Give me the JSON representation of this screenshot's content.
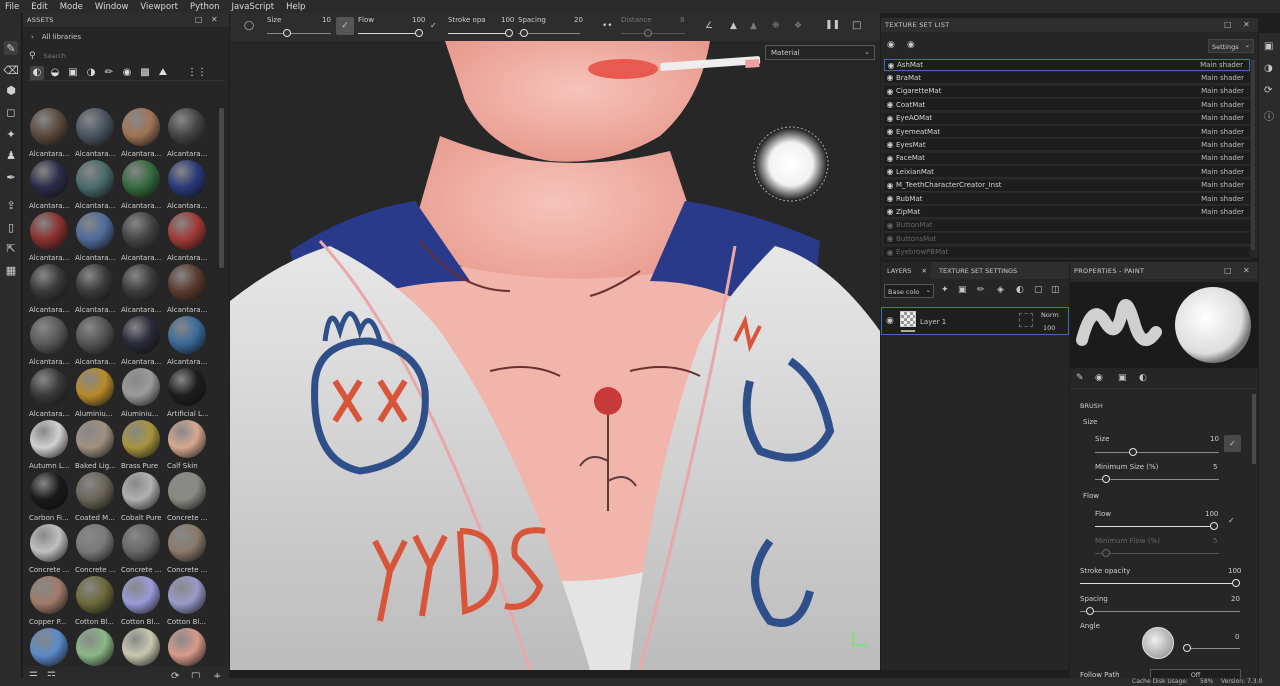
{
  "menu": [
    "File",
    "Edit",
    "Mode",
    "Window",
    "Viewport",
    "Python",
    "JavaScript",
    "Help"
  ],
  "assets": {
    "title": "ASSETS",
    "libraries": "All libraries",
    "search_placeholder": "Search",
    "materials": [
      {
        "label": "Alcantara...",
        "color": "#5a4a3e"
      },
      {
        "label": "Alcantara...",
        "color": "#4a5560"
      },
      {
        "label": "Alcantara...",
        "color": "#a07456"
      },
      {
        "label": "Alcantara...",
        "color": "#454545"
      },
      {
        "label": "Alcantara...",
        "color": "#2c2c4a"
      },
      {
        "label": "Alcantara...",
        "color": "#4a6a6a"
      },
      {
        "label": "Alcantara...",
        "color": "#356a3e"
      },
      {
        "label": "Alcantara...",
        "color": "#2a3a7a"
      },
      {
        "label": "Alcantara...",
        "color": "#8a3030"
      },
      {
        "label": "Alcantara...",
        "color": "#4e6a9a"
      },
      {
        "label": "Alcantara...",
        "color": "#444444"
      },
      {
        "label": "Alcantara...",
        "color": "#a03a36"
      },
      {
        "label": "Alcantara...",
        "color": "#393939"
      },
      {
        "label": "Alcantara...",
        "color": "#3a3a3a"
      },
      {
        "label": "Alcantara...",
        "color": "#3c3c3c"
      },
      {
        "label": "Alcantara...",
        "color": "#5a3a2e"
      },
      {
        "label": "Alcantara...",
        "color": "#5a5a5a"
      },
      {
        "label": "Alcantara...",
        "color": "#555555"
      },
      {
        "label": "Alcantara...",
        "color": "#2a2a3a"
      },
      {
        "label": "Alcantara...",
        "color": "#3a6a9a"
      },
      {
        "label": "Alcantara...",
        "color": "#3a3a3a"
      },
      {
        "label": "Aluminiu...",
        "color": "#b88a2a"
      },
      {
        "label": "Aluminiu...",
        "color": "#9a9a9a"
      },
      {
        "label": "Artificial L...",
        "color": "#1e1e1e"
      },
      {
        "label": "Autumn L...",
        "color": "#d0d0d0"
      },
      {
        "label": "Baked Lig...",
        "color": "#a09080"
      },
      {
        "label": "Brass Pure",
        "color": "#a8953e"
      },
      {
        "label": "Calf Skin",
        "color": "#d8a890"
      },
      {
        "label": "Carbon Fi...",
        "color": "#1a1a1a"
      },
      {
        "label": "Coated M...",
        "color": "#6a6558"
      },
      {
        "label": "Cobalt Pure",
        "color": "#b0b0b0"
      },
      {
        "label": "Concrete ...",
        "color": "#8a8a84"
      },
      {
        "label": "Concrete ...",
        "color": "#c0c0c0"
      },
      {
        "label": "Concrete ...",
        "color": "#7a7a7a"
      },
      {
        "label": "Concrete ...",
        "color": "#686868"
      },
      {
        "label": "Concrete ...",
        "color": "#8a7a6a"
      },
      {
        "label": "Copper P...",
        "color": "#a07a6a"
      },
      {
        "label": "Cotton Bl...",
        "color": "#6a6a3a"
      },
      {
        "label": "Cotton Bl...",
        "color": "#9a9ad8"
      },
      {
        "label": "Cotton Bl...",
        "color": "#9a9ac8"
      },
      {
        "label": "",
        "color": "#5a8ac8"
      },
      {
        "label": "",
        "color": "#8ab888"
      },
      {
        "label": "",
        "color": "#c8c8b0"
      },
      {
        "label": "",
        "color": "#d89a8a"
      }
    ]
  },
  "toolbar": {
    "size_label": "Size",
    "size_value": "10",
    "flow_label": "Flow",
    "flow_value": "100",
    "stroke_label": "Stroke opa",
    "stroke_value": "100",
    "spacing_label": "Spacing",
    "spacing_value": "20",
    "distance_label": "Distance",
    "distance_value": "8"
  },
  "viewport": {
    "material_select": "Material"
  },
  "texture_set_list": {
    "title": "TEXTURE SET LIST",
    "settings": "Settings",
    "rows": [
      {
        "name": "AshMat",
        "shader": "Main shader",
        "enabled": true
      },
      {
        "name": "BraMat",
        "shader": "Main shader",
        "enabled": true
      },
      {
        "name": "CigaretteMat",
        "shader": "Main shader",
        "enabled": true
      },
      {
        "name": "CoatMat",
        "shader": "Main shader",
        "enabled": true
      },
      {
        "name": "EyeAOMat",
        "shader": "Main shader",
        "enabled": true
      },
      {
        "name": "EyemeatMat",
        "shader": "Main shader",
        "enabled": true
      },
      {
        "name": "EyesMat",
        "shader": "Main shader",
        "enabled": true
      },
      {
        "name": "FaceMat",
        "shader": "Main shader",
        "enabled": true
      },
      {
        "name": "LeixianMat",
        "shader": "Main shader",
        "enabled": true
      },
      {
        "name": "M_TeethCharacterCreator_Inst",
        "shader": "Main shader",
        "enabled": true
      },
      {
        "name": "RubMat",
        "shader": "Main shader",
        "enabled": true
      },
      {
        "name": "ZipMat",
        "shader": "Main shader",
        "enabled": true
      },
      {
        "name": "ButtonMat",
        "shader": "",
        "enabled": false
      },
      {
        "name": "ButtonsMat",
        "shader": "",
        "enabled": false
      },
      {
        "name": "EyebrowPBMat",
        "shader": "",
        "enabled": false
      }
    ]
  },
  "layers": {
    "tab_layers": "LAYERS",
    "tab_tss": "TEXTURE SET SETTINGS",
    "channel": "Base colo",
    "layer_name": "Layer 1",
    "blend": "Norm",
    "opacity": "100"
  },
  "properties": {
    "title": "PROPERTIES - PAINT",
    "section": "BRUSH",
    "size_group": "Size",
    "size_label": "Size",
    "size_value": "10",
    "min_size_label": "Minimum Size (%)",
    "min_size_value": "5",
    "flow_group": "Flow",
    "flow_label": "Flow",
    "flow_value": "100",
    "min_flow_label": "Minimum Flow (%)",
    "min_flow_value": "5",
    "stroke_label": "Stroke opacity",
    "stroke_value": "100",
    "spacing_label": "Spacing",
    "spacing_value": "20",
    "angle_label": "Angle",
    "angle_value": "0",
    "follow_label": "Follow Path",
    "follow_value": "Off"
  },
  "status": {
    "cache": "Cache Disk Usage:",
    "cache_value": "58%",
    "version": "Version: 7.3.0"
  }
}
